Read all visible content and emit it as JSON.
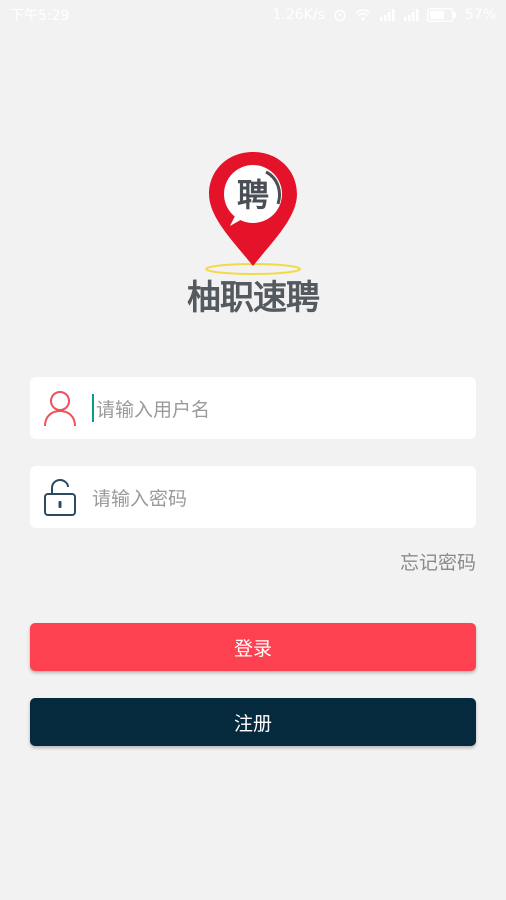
{
  "status_bar": {
    "time": "下午5:29",
    "net_speed": "1.26K/s",
    "battery": "57%"
  },
  "logo": {
    "badge_char": "聘",
    "app_name": "柚职速聘"
  },
  "login_form": {
    "username_placeholder": "请输入用户名",
    "password_placeholder": "请输入密码",
    "forgot_password": "忘记密码",
    "login_button": "登录",
    "register_button": "注册"
  },
  "colors": {
    "login": "#fe4150",
    "register": "#052a3e",
    "logo_red": "#e5132a"
  }
}
